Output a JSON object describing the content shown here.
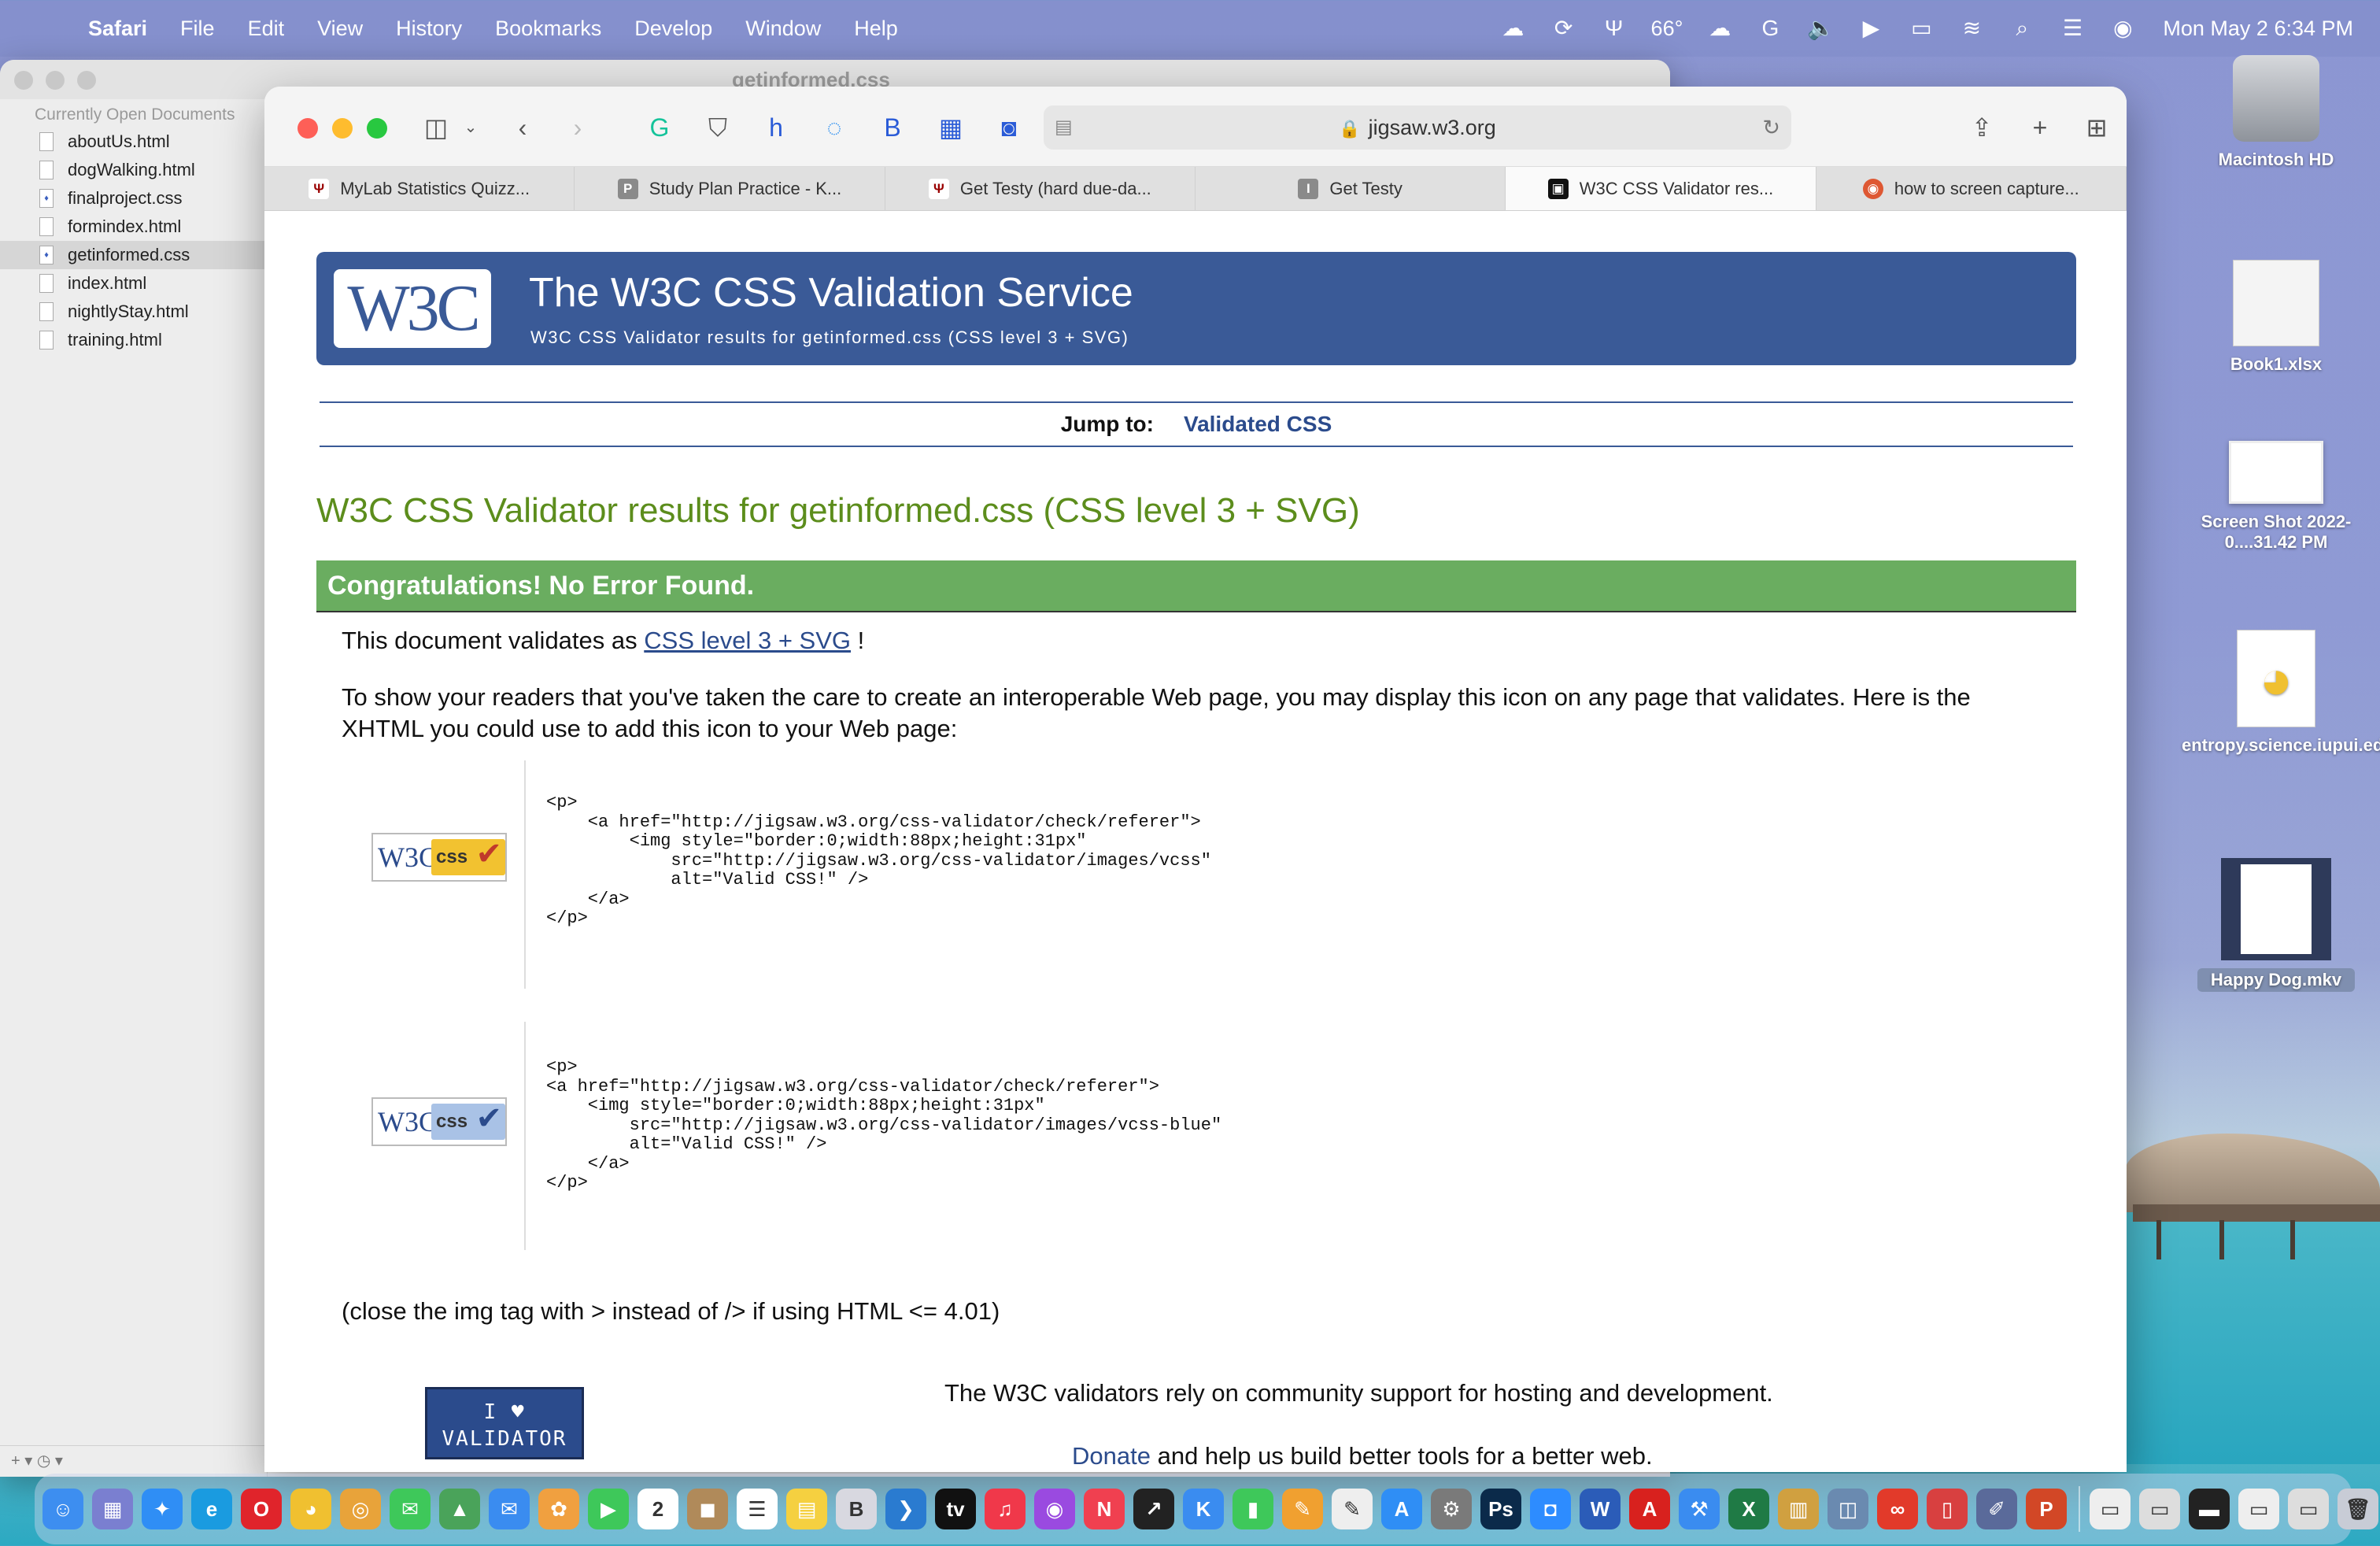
{
  "menubar": {
    "app": "Safari",
    "items": [
      "File",
      "Edit",
      "View",
      "History",
      "Bookmarks",
      "Develop",
      "Window",
      "Help"
    ],
    "temperature": "66°",
    "clock": "Mon May 2  6:34 PM"
  },
  "editor": {
    "window_title": "getinformed.css",
    "sidebar_header": "Currently Open Documents",
    "documents": [
      {
        "name": "aboutUs.html",
        "kind": "html"
      },
      {
        "name": "dogWalking.html",
        "kind": "html"
      },
      {
        "name": "finalproject.css",
        "kind": "css"
      },
      {
        "name": "formindex.html",
        "kind": "html"
      },
      {
        "name": "getinformed.css",
        "kind": "css",
        "selected": true
      },
      {
        "name": "index.html",
        "kind": "html"
      },
      {
        "name": "nightlyStay.html",
        "kind": "html"
      },
      {
        "name": "training.html",
        "kind": "html"
      }
    ],
    "footer": "+ ▾   ◷ ▾"
  },
  "safari": {
    "url": "jigsaw.w3.org",
    "tabs": [
      {
        "title": "MyLab Statistics Quizz...",
        "favicon": "Ψ",
        "color": "#990000"
      },
      {
        "title": "Study Plan Practice - K...",
        "favicon": "P",
        "color": "#8a8a8a"
      },
      {
        "title": "Get Testy (hard due-da...",
        "favicon": "Ψ",
        "color": "#990000"
      },
      {
        "title": "Get Testy",
        "favicon": "I",
        "color": "#8a8a8a"
      },
      {
        "title": "W3C CSS Validator res...",
        "favicon": "▣",
        "color": "#111111",
        "active": true
      },
      {
        "title": "how to screen capture...",
        "favicon": "◉",
        "color": "#de5833"
      }
    ]
  },
  "page": {
    "banner_title": "The W3C CSS Validation Service",
    "banner_subtitle": "W3C CSS Validator results for getinformed.css (CSS level 3 + SVG)",
    "logo_text": "W3C",
    "jump_label": "Jump to:",
    "jump_link": "Validated CSS",
    "results_title": "W3C CSS Validator results for getinformed.css (CSS level 3 + SVG)",
    "congrats": "Congratulations! No Error Found.",
    "validates_prefix": "This document validates as",
    "validates_link": "CSS level 3 + SVG",
    "validates_suffix": "!",
    "show_readers": "To show your readers that you've taken the care to create an interoperable Web page, you may display this icon on any page that validates. Here is the XHTML you could use to add this icon to your Web page:",
    "code1": "<p>\n    <a href=\"http://jigsaw.w3.org/css-validator/check/referer\">\n        <img style=\"border:0;width:88px;height:31px\"\n            src=\"http://jigsaw.w3.org/css-validator/images/vcss\"\n            alt=\"Valid CSS!\" />\n    </a>\n</p>",
    "code2": "<p>\n<a href=\"http://jigsaw.w3.org/css-validator/check/referer\">\n    <img style=\"border:0;width:88px;height:31px\"\n        src=\"http://jigsaw.w3.org/css-validator/images/vcss-blue\"\n        alt=\"Valid CSS!\" />\n    </a>\n</p>",
    "badge_w3c": "W3C",
    "badge_css": "css",
    "close_tag_note": "(close the img tag with > instead of /> if using HTML <= 4.01)",
    "heart_badge_line1": "I ♥",
    "heart_badge_line2": "VALIDATOR",
    "support_text": "The W3C validators rely on community support for hosting and development.",
    "donate_link": "Donate",
    "donate_suffix": "and help us build better tools for a better web."
  },
  "desktop": {
    "icons": [
      {
        "label": "Macintosh HD"
      },
      {
        "label": "Book1.xlsx"
      },
      {
        "label": "Screen Shot 2022-0....31.42 PM"
      },
      {
        "label": "entropy.science.iupui.edu...FTP.duck"
      },
      {
        "label": "Happy Dog.mkv"
      }
    ]
  },
  "dock": {
    "apps": [
      {
        "name": "finder",
        "glyph": "☺",
        "color": "#3d8ef0"
      },
      {
        "name": "launchpad",
        "glyph": "▦",
        "color": "#7a7fd0"
      },
      {
        "name": "safari",
        "glyph": "✦",
        "color": "#2f8ef5"
      },
      {
        "name": "chrome-edge",
        "glyph": "e",
        "color": "#1a9be0"
      },
      {
        "name": "opera",
        "glyph": "O",
        "color": "#e0242b"
      },
      {
        "name": "cyberduck",
        "glyph": "◕",
        "color": "#f0c030"
      },
      {
        "name": "chrome",
        "glyph": "◎",
        "color": "#e8a33a"
      },
      {
        "name": "messages",
        "glyph": "✉",
        "color": "#3ec85a"
      },
      {
        "name": "maps",
        "glyph": "▲",
        "color": "#4aa35a"
      },
      {
        "name": "mail",
        "glyph": "✉",
        "color": "#3a8cf0"
      },
      {
        "name": "photos",
        "glyph": "✿",
        "color": "#f0a040"
      },
      {
        "name": "facetime",
        "glyph": "▶",
        "color": "#3ec85a"
      },
      {
        "name": "calendar",
        "glyph": "2",
        "color": "#ffffff"
      },
      {
        "name": "contacts",
        "glyph": "◼",
        "color": "#b08a5a"
      },
      {
        "name": "reminders",
        "glyph": "☰",
        "color": "#ffffff"
      },
      {
        "name": "notes",
        "glyph": "▤",
        "color": "#f5d040"
      },
      {
        "name": "bbedit",
        "glyph": "B",
        "color": "#d8d8e0"
      },
      {
        "name": "vscode",
        "glyph": "❯",
        "color": "#2a7bd0"
      },
      {
        "name": "tv",
        "glyph": "tv",
        "color": "#111111"
      },
      {
        "name": "music",
        "glyph": "♫",
        "color": "#f0384a"
      },
      {
        "name": "podcasts",
        "glyph": "◉",
        "color": "#9a4ae0"
      },
      {
        "name": "news",
        "glyph": "N",
        "color": "#f04050"
      },
      {
        "name": "stocks",
        "glyph": "↗",
        "color": "#222222"
      },
      {
        "name": "keynote",
        "glyph": "K",
        "color": "#3a8cf0"
      },
      {
        "name": "numbers",
        "glyph": "▮",
        "color": "#3ec85a"
      },
      {
        "name": "pages",
        "glyph": "✎",
        "color": "#f0a030"
      },
      {
        "name": "textedit",
        "glyph": "✎",
        "color": "#eeeeee"
      },
      {
        "name": "app-store",
        "glyph": "A",
        "color": "#2f8ef5"
      },
      {
        "name": "settings",
        "glyph": "⚙",
        "color": "#7a7a7a"
      },
      {
        "name": "photoshop",
        "glyph": "Ps",
        "color": "#0b2a4a"
      },
      {
        "name": "zoom",
        "glyph": "◘",
        "color": "#2d8cff"
      },
      {
        "name": "word",
        "glyph": "W",
        "color": "#2b5cb8"
      },
      {
        "name": "acrobat",
        "glyph": "A",
        "color": "#d8211e"
      },
      {
        "name": "xcode",
        "glyph": "⚒",
        "color": "#3a8cf0"
      },
      {
        "name": "excel",
        "glyph": "X",
        "color": "#1f7a45"
      },
      {
        "name": "archive",
        "glyph": "▥",
        "color": "#d0a040"
      },
      {
        "name": "preview",
        "glyph": "◫",
        "color": "#6a8ab0"
      },
      {
        "name": "creative-cloud",
        "glyph": "∞",
        "color": "#e23a2a"
      },
      {
        "name": "flashcards",
        "glyph": "▯",
        "color": "#d84040"
      },
      {
        "name": "pen-app",
        "glyph": "✐",
        "color": "#5a6a9a"
      },
      {
        "name": "powerpoint",
        "glyph": "P",
        "color": "#d24726"
      },
      {
        "name": "recent-1",
        "glyph": "▭",
        "color": "#eeeeee"
      },
      {
        "name": "recent-2",
        "glyph": "▭",
        "color": "#dddddd"
      },
      {
        "name": "recent-3",
        "glyph": "▬",
        "color": "#222222"
      },
      {
        "name": "recent-4",
        "glyph": "▭",
        "color": "#eeeeee"
      },
      {
        "name": "recent-5",
        "glyph": "▭",
        "color": "#dddddd"
      },
      {
        "name": "trash",
        "glyph": "🗑",
        "color": "#c8ccd6"
      }
    ]
  }
}
